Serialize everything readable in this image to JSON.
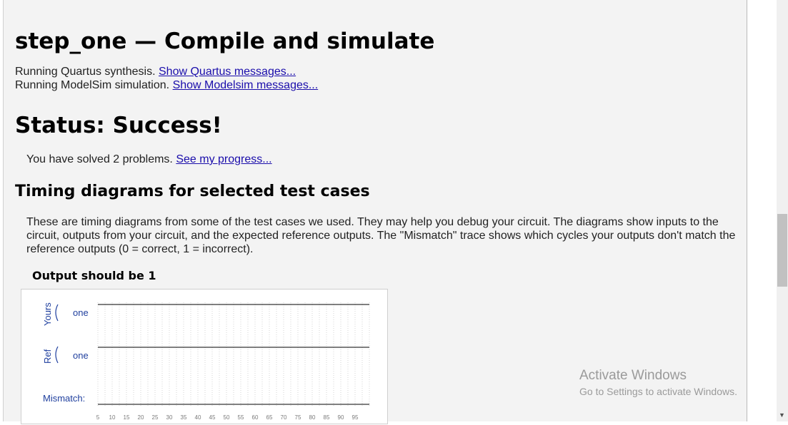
{
  "heading": {
    "title": "step_one — Compile and simulate"
  },
  "log": {
    "quartus_text": "Running Quartus synthesis.",
    "quartus_link": "Show Quartus messages...",
    "modelsim_text": "Running ModelSim simulation.",
    "modelsim_link": "Show Modelsim messages..."
  },
  "status": {
    "title": "Status: Success!",
    "solved_text": "You have solved 2 problems.",
    "progress_link": "See my progress..."
  },
  "timing": {
    "heading": "Timing diagrams for selected test cases",
    "description": "These are timing diagrams from some of the test cases we used. They may help you debug your circuit. The diagrams show inputs to the circuit, outputs from your circuit, and the expected reference outputs. The \"Mismatch\" trace shows which cycles your outputs don't match the reference outputs (0 = correct, 1 = incorrect).",
    "case_title": "Output should be 1",
    "diagram": {
      "group_yours": "Yours",
      "group_ref": "Ref",
      "signal_yours": "one",
      "signal_ref": "one",
      "mismatch_label": "Mismatch:",
      "ticks": [
        "5",
        "10",
        "15",
        "20",
        "25",
        "30",
        "35",
        "40",
        "45",
        "50",
        "55",
        "60",
        "65",
        "70",
        "75",
        "80",
        "85",
        "90",
        "95"
      ],
      "yours_level": 1,
      "ref_level": 1,
      "mismatch_level": 0,
      "signal_color": "#1f3f9e"
    }
  },
  "watermark": {
    "line1": "Activate Windows",
    "line2": "Go to Settings to activate Windows."
  },
  "colors": {
    "link": "#1a0dab",
    "panel_bg": "#f3f3f3"
  }
}
